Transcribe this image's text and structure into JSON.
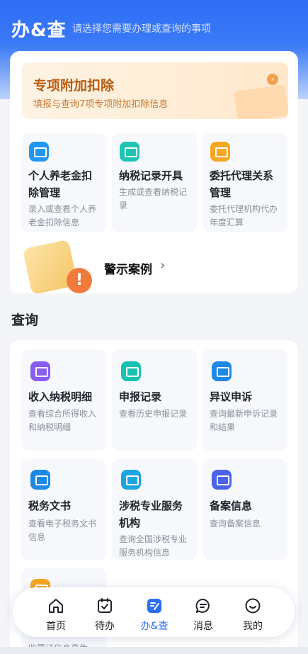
{
  "header": {
    "title": "办&查",
    "subtitle": "请选择您需要办理或查询的事项"
  },
  "banner": {
    "title": "专项附加扣除",
    "subtitle": "填报与查询7项专项附加扣除信息"
  },
  "handle_items": [
    {
      "title": "个人养老金扣除管理",
      "desc": "录入或查看个人养老金扣除信息",
      "icon": "pension-icon",
      "color": "#2296f3"
    },
    {
      "title": "纳税记录开具",
      "desc": "生成或查看纳税记录",
      "icon": "tax-record-icon",
      "color": "#20c4b4"
    },
    {
      "title": "委托代理关系管理",
      "desc": "委托代理机构代办年度汇算",
      "icon": "agent-icon",
      "color": "#f5a623"
    }
  ],
  "warning": {
    "label": "警示案例"
  },
  "query_section": {
    "title": "查询"
  },
  "query_items": [
    {
      "title": "收入纳税明细",
      "desc": "查看综合所得收入和纳税明细",
      "icon": "income-icon",
      "color": "#8a5cf0"
    },
    {
      "title": "申报记录",
      "desc": "查看历史申报记录",
      "icon": "declare-record-icon",
      "color": "#18c2b0"
    },
    {
      "title": "异议申诉",
      "desc": "查询最新申诉记录和结果",
      "icon": "appeal-icon",
      "color": "#1e88e5"
    },
    {
      "title": "税务文书",
      "desc": "查看电子税务文书信息",
      "icon": "document-icon",
      "color": "#1e88e5"
    },
    {
      "title": "涉税专业服务机构",
      "desc": "查询全国涉税专业服务机构信息",
      "icon": "institution-icon",
      "color": "#1ba4e0"
    },
    {
      "title": "备案信息",
      "desc": "查询备案信息",
      "icon": "filing-icon",
      "color": "#4a63e8"
    },
    {
      "title": "",
      "desc": "收票证信息真伪",
      "icon": "receipt-icon",
      "color": "#f5a623"
    }
  ],
  "nav": [
    {
      "label": "首页",
      "icon": "home-icon"
    },
    {
      "label": "待办",
      "icon": "todo-icon"
    },
    {
      "label": "办&查",
      "icon": "handle-query-icon"
    },
    {
      "label": "消息",
      "icon": "message-icon"
    },
    {
      "label": "我的",
      "icon": "profile-icon"
    }
  ],
  "colors": {
    "brand": "#2f6df5",
    "active_nav": "#2b6df3",
    "banner_text": "#b85c10"
  }
}
